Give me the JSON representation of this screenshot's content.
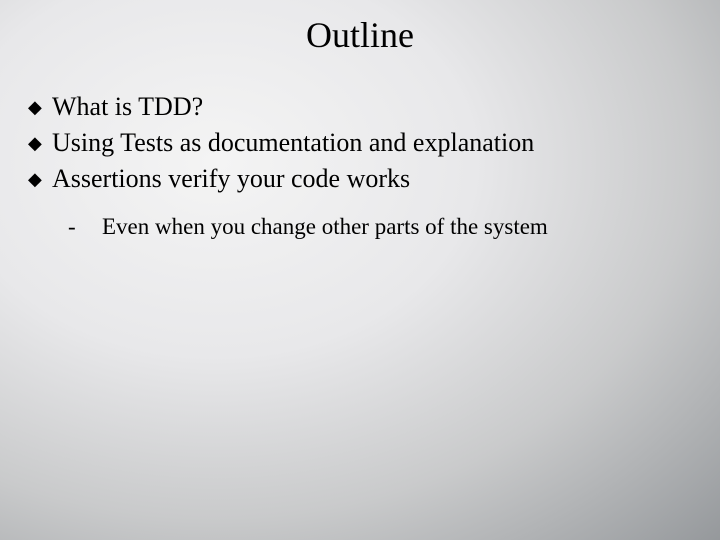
{
  "title": "Outline",
  "bullets": [
    {
      "text": "What is TDD?"
    },
    {
      "text": "Using Tests as documentation and explanation"
    },
    {
      "text": "Assertions verify your code works"
    }
  ],
  "subbullets": [
    {
      "text": "Even when you change other parts of the system"
    }
  ],
  "marks": {
    "main": "◆",
    "sub": "-"
  }
}
